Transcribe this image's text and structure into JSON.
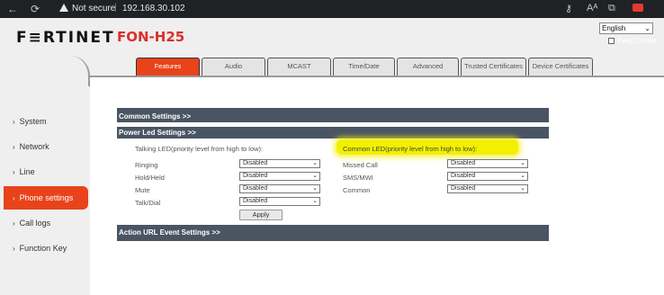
{
  "browser": {
    "security_label": "Not secure",
    "separator": "|",
    "url": "192.168.30.102",
    "back_icon": "←",
    "reload_icon": "⟳",
    "read_aloud_label": "Aᴬ",
    "right_icons": [
      "key-icon",
      "read-aloud-icon",
      "tabs-icon",
      "youtube-icon"
    ]
  },
  "header": {
    "brand": "F≡RTINET",
    "model": "FON-H25",
    "language": "English",
    "keep_online": "Keep Online"
  },
  "tabs": [
    {
      "label": "Features",
      "active": true
    },
    {
      "label": "Audio"
    },
    {
      "label": "MCAST"
    },
    {
      "label": "Time/Date"
    },
    {
      "label": "Advanced"
    },
    {
      "label": "Trusted Certificates"
    },
    {
      "label": "Device Certificates"
    }
  ],
  "sidebar": [
    {
      "label": "System"
    },
    {
      "label": "Network"
    },
    {
      "label": "Line"
    },
    {
      "label": "Phone settings",
      "active": true
    },
    {
      "label": "Call logs"
    },
    {
      "label": "Function Key"
    }
  ],
  "sections": {
    "common": "Common Settings >>",
    "power_led": "Power Led Settings >>",
    "action_url": "Action URL Event Settings >>"
  },
  "talking_led": {
    "heading": "Talking LED(priority level from high to low):",
    "rows": [
      {
        "label": "Ringing",
        "value": "Disabled"
      },
      {
        "label": "Hold/Held",
        "value": "Disabled"
      },
      {
        "label": "Mute",
        "value": "Disabled"
      },
      {
        "label": "Talk/Dial",
        "value": "Disabled"
      }
    ]
  },
  "common_led": {
    "heading": "Common LED(priority level from high to low):",
    "rows": [
      {
        "label": "Missed Call",
        "value": "Disabled"
      },
      {
        "label": "SMS/MWI",
        "value": "Disabled"
      },
      {
        "label": "Common",
        "value": "Disabled"
      }
    ]
  },
  "apply_label": "Apply",
  "colors": {
    "accent": "#e8431b",
    "brand_red": "#d8312a",
    "section_bar": "#4a5563",
    "highlight": "#f2f000"
  }
}
